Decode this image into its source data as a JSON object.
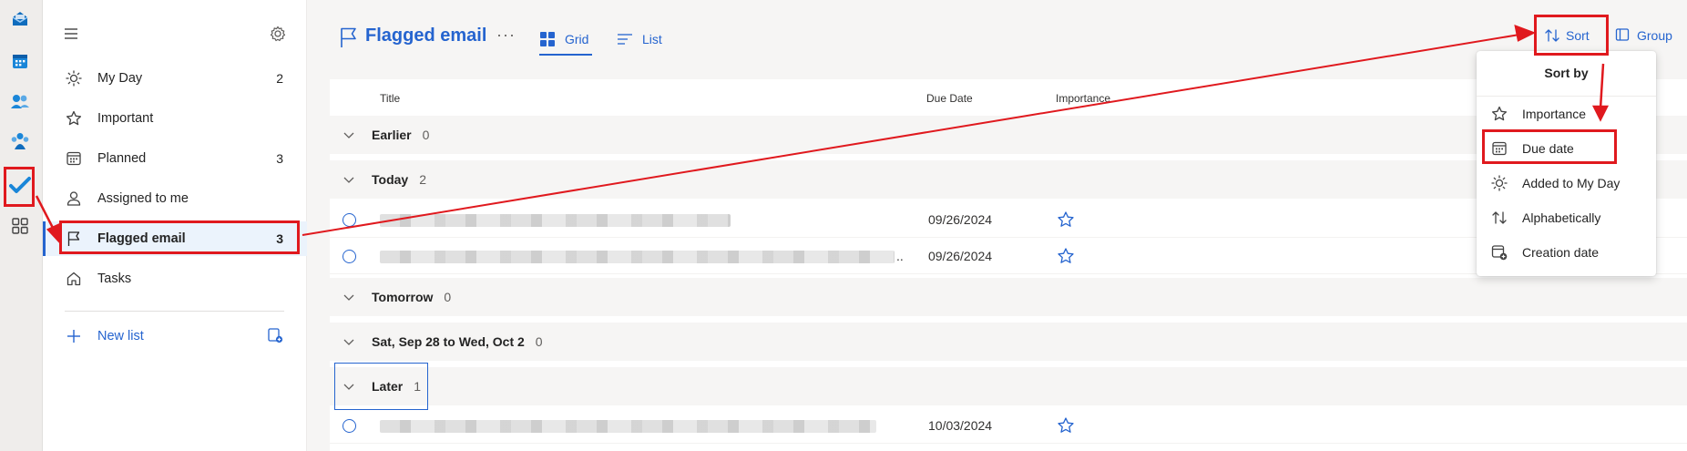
{
  "rail": {
    "items": [
      {
        "name": "outlook-mail-icon"
      },
      {
        "name": "calendar-icon"
      },
      {
        "name": "people-icon"
      },
      {
        "name": "teams-icon"
      },
      {
        "name": "todo-check-icon"
      },
      {
        "name": "apps-grid-icon"
      }
    ]
  },
  "nav": {
    "items": [
      {
        "label": "My Day",
        "count": "2",
        "icon": "sun-icon"
      },
      {
        "label": "Important",
        "count": "",
        "icon": "star-icon"
      },
      {
        "label": "Planned",
        "count": "3",
        "icon": "calendar-icon"
      },
      {
        "label": "Assigned to me",
        "count": "",
        "icon": "person-icon"
      },
      {
        "label": "Flagged email",
        "count": "3",
        "icon": "flag-icon"
      },
      {
        "label": "Tasks",
        "count": "",
        "icon": "home-icon"
      }
    ],
    "new_list": "New list"
  },
  "header": {
    "title": "Flagged email",
    "more": "···",
    "tab_grid": "Grid",
    "tab_list": "List",
    "sort": "Sort",
    "group": "Group"
  },
  "table": {
    "col_title": "Title",
    "col_due": "Due Date",
    "col_importance": "Importance",
    "groups": [
      {
        "name": "Earlier",
        "count": "0"
      },
      {
        "name": "Today",
        "count": "2"
      },
      {
        "name": "Tomorrow",
        "count": "0"
      },
      {
        "name": "Sat, Sep 28 to Wed, Oct 2",
        "count": "0"
      },
      {
        "name": "Later",
        "count": "1"
      }
    ],
    "rows": [
      {
        "due": "09/26/2024",
        "trail": ""
      },
      {
        "due": "09/26/2024",
        "trail": ".."
      },
      {
        "due": "10/03/2024",
        "trail": ""
      }
    ]
  },
  "sort_menu": {
    "title": "Sort by",
    "items": [
      {
        "label": "Importance",
        "icon": "star-icon"
      },
      {
        "label": "Due date",
        "icon": "calendar-icon"
      },
      {
        "label": "Added to My Day",
        "icon": "sun-icon"
      },
      {
        "label": "Alphabetically",
        "icon": "sort-arrows-icon"
      },
      {
        "label": "Creation date",
        "icon": "calendar-add-icon"
      }
    ]
  },
  "colors": {
    "accent": "#2564cf",
    "annotation": "#e0191e"
  }
}
